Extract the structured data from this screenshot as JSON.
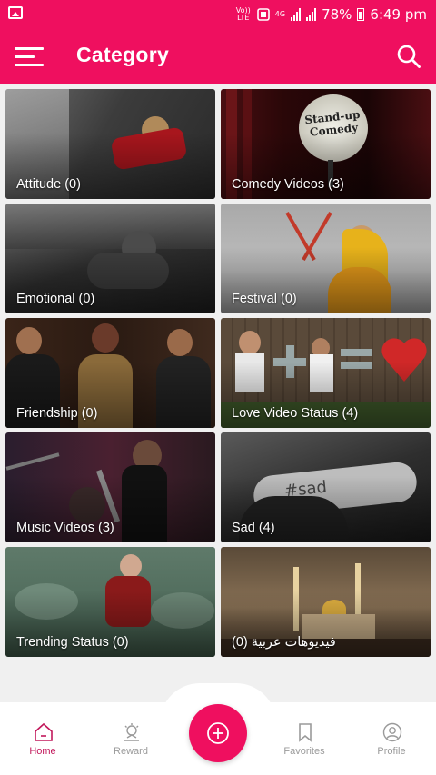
{
  "status_bar": {
    "volte_text": "Vo)) LTE",
    "network_text": "4G",
    "battery_text": "78%",
    "time": "6:49 pm"
  },
  "app_bar": {
    "title": "Category"
  },
  "categories": [
    {
      "label": "Attitude (0)"
    },
    {
      "label": "Comedy Videos (3)"
    },
    {
      "label": "Emotional (0)"
    },
    {
      "label": "Festival (0)"
    },
    {
      "label": "Friendship (0)"
    },
    {
      "label": "Love Video Status (4)"
    },
    {
      "label": "Music Videos (3)"
    },
    {
      "label": "Sad (4)"
    },
    {
      "label": "Trending Status (0)"
    },
    {
      "label": "(0) فيديوهات عربية"
    }
  ],
  "bottom_nav": {
    "home": "Home",
    "reward": "Reward",
    "favorites": "Favorites",
    "profile": "Profile",
    "active_color": "#c2185b"
  },
  "colors": {
    "primary": "#ef0f5f"
  }
}
